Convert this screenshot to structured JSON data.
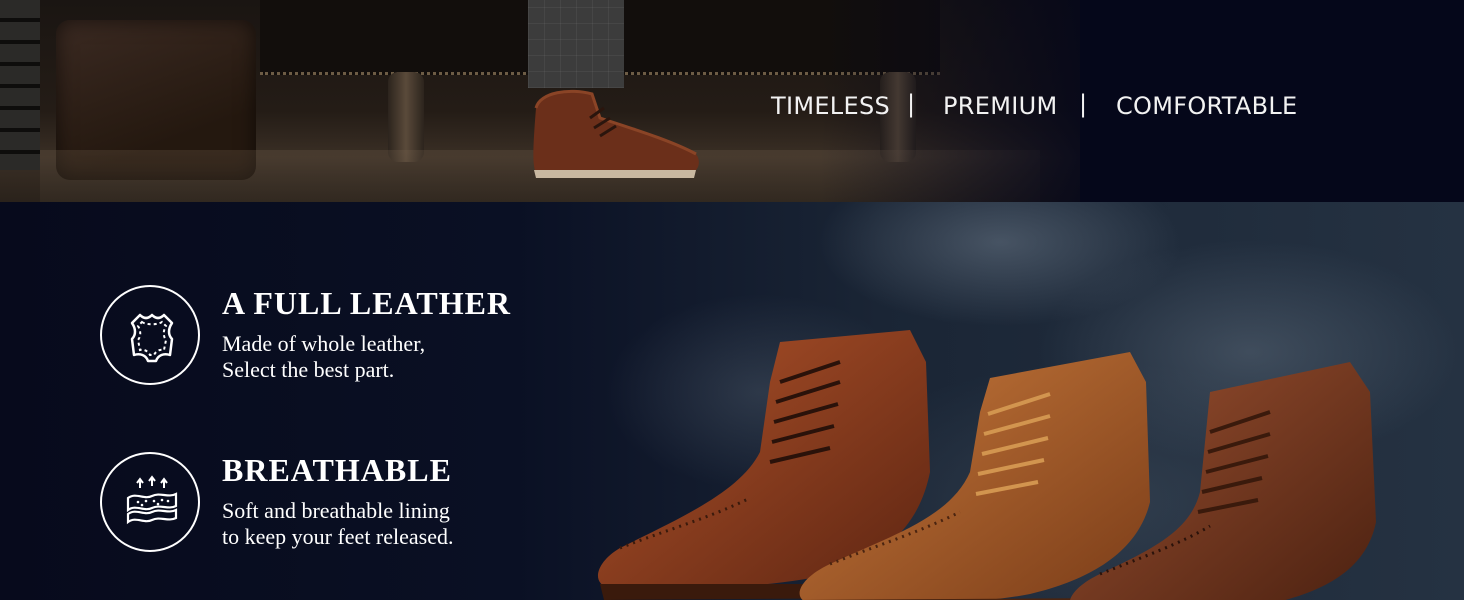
{
  "banner": {
    "taglines": [
      "TIMELESS",
      "PREMIUM",
      "COMFORTABLE"
    ],
    "separator": "|"
  },
  "features": [
    {
      "icon": "leather-hide-icon",
      "title": "A FULL LEATHER",
      "lines": [
        "Made of whole leather,",
        "Select the best part."
      ]
    },
    {
      "icon": "breathable-lining-icon",
      "title": "BREATHABLE",
      "lines": [
        "Soft and breathable lining",
        "to keep your feet released."
      ]
    }
  ],
  "colors": {
    "navy": "#070a1c",
    "leather_dark": "#6b2f1a",
    "leather_light": "#a4562a",
    "text": "#ffffff"
  }
}
